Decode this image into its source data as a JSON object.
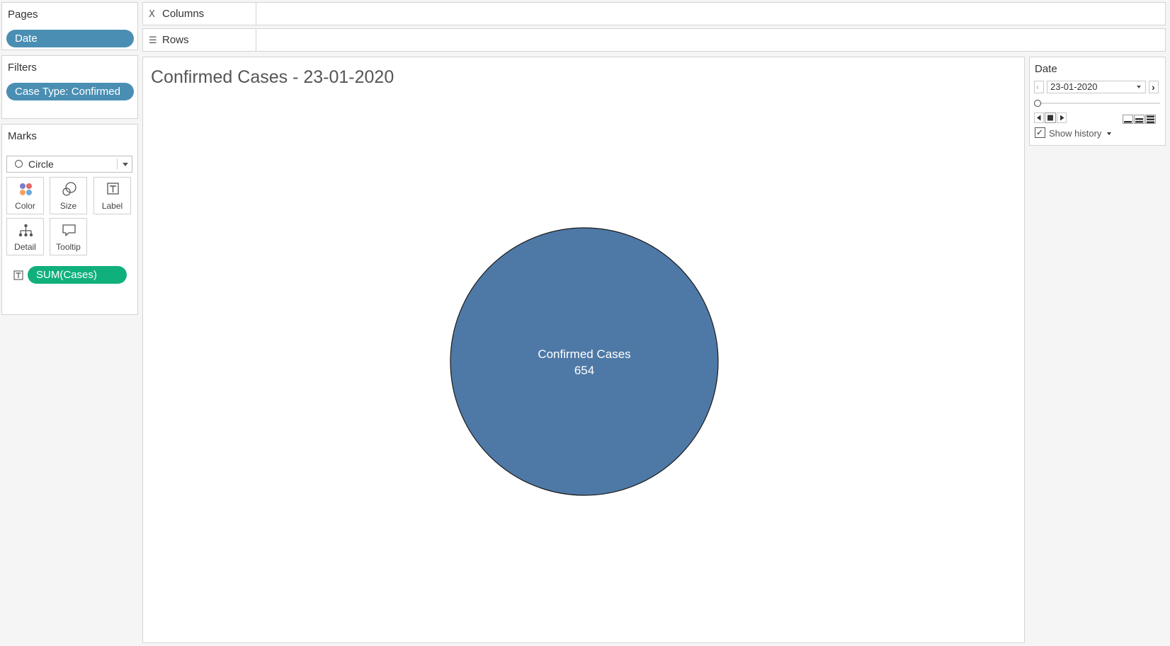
{
  "pages": {
    "title": "Pages",
    "pill": "Date"
  },
  "filters": {
    "title": "Filters",
    "pill": "Case Type: Confirmed"
  },
  "marks": {
    "title": "Marks",
    "mark_type": "Circle",
    "buttons": {
      "color": "Color",
      "size": "Size",
      "label": "Label",
      "detail": "Detail",
      "tooltip": "Tooltip"
    },
    "field_pill": "SUM(Cases)"
  },
  "shelves": {
    "columns": "Columns",
    "rows": "Rows"
  },
  "viz": {
    "title": "Confirmed Cases - 23-01-2020",
    "circle_label": "Confirmed Cases",
    "circle_value": "654",
    "circle_color": "#4e79a7"
  },
  "date_control": {
    "title": "Date",
    "current": "23-01-2020",
    "slider_position": 0,
    "show_history_label": "Show history",
    "show_history_checked": true
  }
}
